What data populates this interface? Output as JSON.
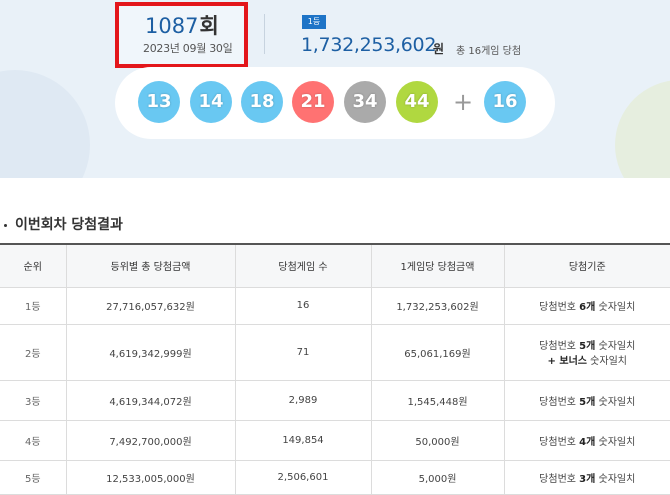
{
  "draw": {
    "round_number": "1087",
    "round_suffix": "회",
    "date": "2023년 09월 30일",
    "rank_badge": "1등",
    "first_prize_amount": "1,732,253,602",
    "first_prize_unit": "원",
    "winners_text": "총 16게임 당첨",
    "numbers": [
      "13",
      "14",
      "18",
      "21",
      "34",
      "44"
    ],
    "bonus": "16",
    "plus": "+",
    "ball_colors": [
      "#69c8f2",
      "#69c8f2",
      "#69c8f2",
      "#ff7272",
      "#aaaaaa",
      "#b0d840",
      "#69c8f2"
    ]
  },
  "section": {
    "title": "이번회차 당첨결과"
  },
  "table": {
    "headers": [
      "순위",
      "등위별 총 당첨금액",
      "당첨게임 수",
      "1게임당 당첨금액",
      "당첨기준"
    ],
    "rows": [
      {
        "rank": "1등",
        "total": "27,716,057,632원",
        "games": "16",
        "per_game": "1,732,253,602원",
        "crit_pre": "당첨번호 ",
        "crit_bold": "6개",
        "crit_post": " 숫자일치",
        "crit_line2_bold": "",
        "crit_line2": ""
      },
      {
        "rank": "2등",
        "total": "4,619,342,999원",
        "games": "71",
        "per_game": "65,061,169원",
        "crit_pre": "당첨번호 ",
        "crit_bold": "5개",
        "crit_post": " 숫자일치",
        "crit_line2_bold": "+ 보너스",
        "crit_line2": " 숫자일치"
      },
      {
        "rank": "3등",
        "total": "4,619,344,072원",
        "games": "2,989",
        "per_game": "1,545,448원",
        "crit_pre": "당첨번호 ",
        "crit_bold": "5개",
        "crit_post": " 숫자일치",
        "crit_line2_bold": "",
        "crit_line2": ""
      },
      {
        "rank": "4등",
        "total": "7,492,700,000원",
        "games": "149,854",
        "per_game": "50,000원",
        "crit_pre": "당첨번호 ",
        "crit_bold": "4개",
        "crit_post": " 숫자일치",
        "crit_line2_bold": "",
        "crit_line2": ""
      },
      {
        "rank": "5등",
        "total": "12,533,005,000원",
        "games": "2,506,601",
        "per_game": "5,000원",
        "crit_pre": "당첨번호 ",
        "crit_bold": "3개",
        "crit_post": " 숫자일치",
        "crit_line2_bold": "",
        "crit_line2": ""
      }
    ]
  }
}
